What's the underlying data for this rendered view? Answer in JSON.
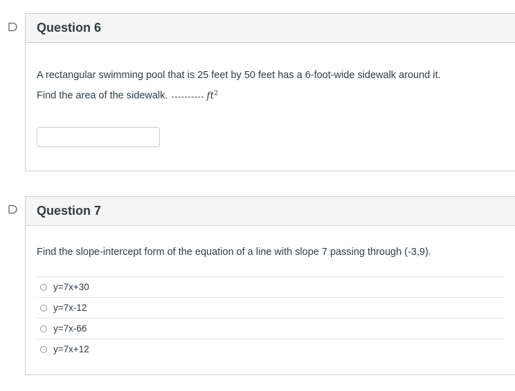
{
  "questions": [
    {
      "title": "Question 6",
      "text": "A rectangular swimming pool that is 25 feet by 50 feet has a 6-foot-wide sidewalk around it.",
      "prompt": "Find the area of the sidewalk.",
      "unit": "ft",
      "unit_exponent": "2",
      "answer_value": ""
    },
    {
      "title": "Question 7",
      "text": "Find the slope-intercept form of the equation of a line with slope 7 passing through (-3,9).",
      "options": [
        "y=7x+30",
        "y=7x-12",
        "y=7x-66",
        "y=7x+12"
      ]
    }
  ],
  "icons": {
    "flag": "flag-icon"
  }
}
